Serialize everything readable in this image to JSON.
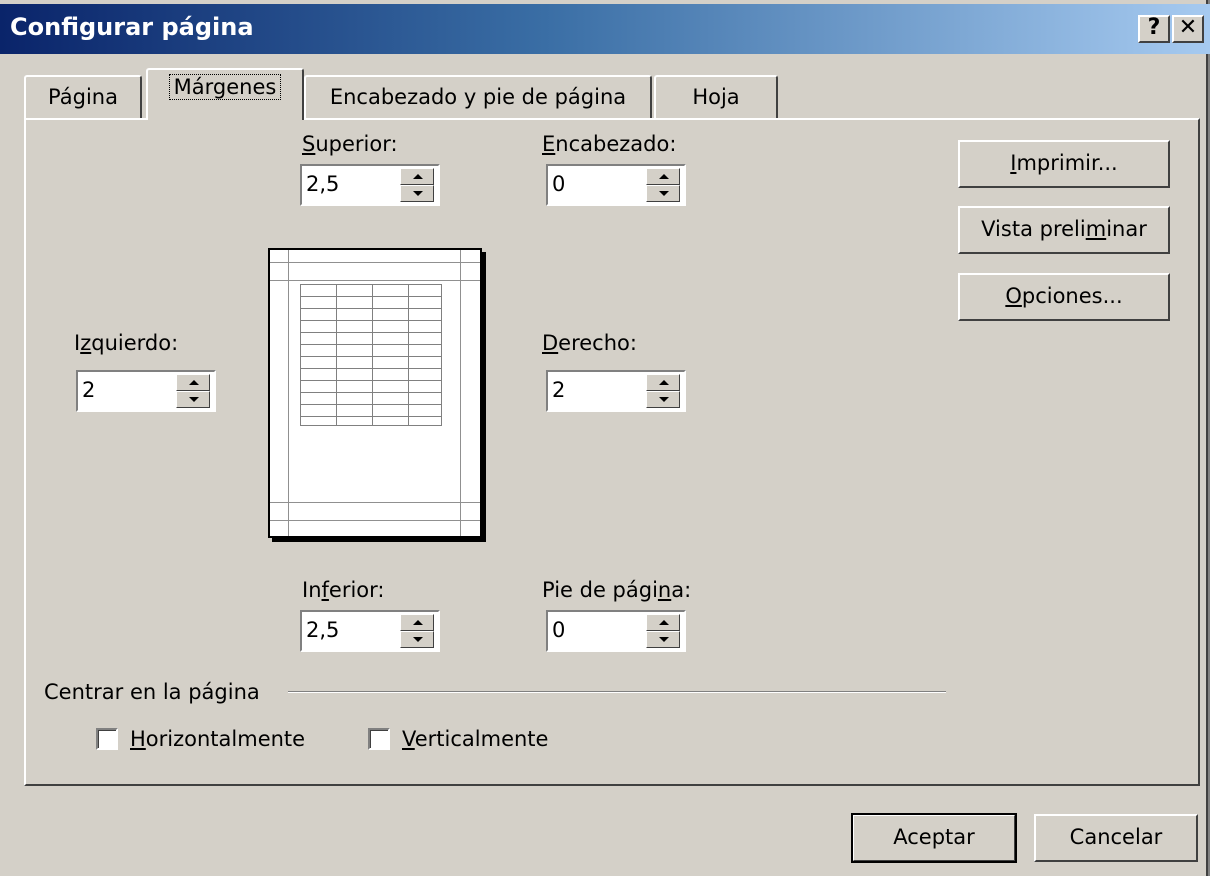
{
  "window": {
    "title": "Configurar página",
    "help_label": "?",
    "close_label": "✕"
  },
  "tabs": [
    {
      "label": "Página",
      "active": false
    },
    {
      "label": "Márgenes",
      "active": true
    },
    {
      "label": "Encabezado y pie de página",
      "active": false
    },
    {
      "label": "Hoja",
      "active": false
    }
  ],
  "margins": {
    "superior": {
      "label_pre": "",
      "label_key": "S",
      "label_post": "uperior:",
      "value": "2,5"
    },
    "encabezado": {
      "label_pre": "",
      "label_key": "E",
      "label_post": "ncabezado:",
      "value": "0"
    },
    "izquierdo": {
      "label_pre": "I",
      "label_key": "z",
      "label_post": "quierdo:",
      "value": "2"
    },
    "derecho": {
      "label_pre": "",
      "label_key": "D",
      "label_post": "erecho:",
      "value": "2"
    },
    "inferior": {
      "label_pre": "In",
      "label_key": "f",
      "label_post": "erior:",
      "value": "2,5"
    },
    "pie": {
      "label_pre": "Pie de pági",
      "label_key": "n",
      "label_post": "a:",
      "value": "0"
    }
  },
  "side_buttons": {
    "imprimir": {
      "pre": "",
      "key": "I",
      "post": "mprimir..."
    },
    "vista": {
      "pre": "Vista preli",
      "key": "m",
      "post": "inar"
    },
    "opciones": {
      "pre": "",
      "key": "O",
      "post": "pciones..."
    }
  },
  "center_group": {
    "label": "Centrar en la página",
    "horizontal": {
      "key": "H",
      "post": "orizontalmente",
      "checked": false
    },
    "vertical": {
      "key": "V",
      "post": "erticalmente",
      "checked": false
    }
  },
  "footer": {
    "ok_label": "Aceptar",
    "cancel_label": "Cancelar"
  }
}
